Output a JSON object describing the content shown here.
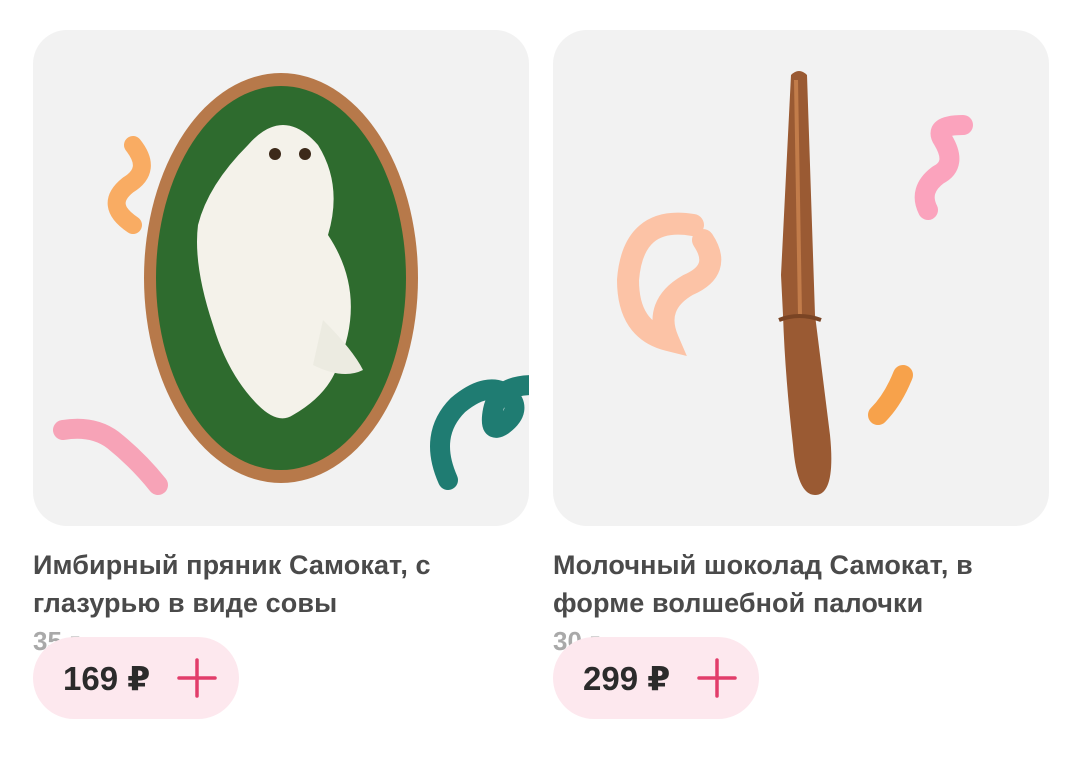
{
  "products": [
    {
      "title_line1": "Имбирный пряник Самокат, с",
      "title_line2": "глазурью в виде совы",
      "weight": "35 г",
      "price": "169 ₽",
      "image": "owl-gingerbread"
    },
    {
      "title_line1": "Молочный шоколад Самокат, в",
      "title_line2": "форме волшебной палочки",
      "weight": "30 г",
      "price": "299 ₽",
      "image": "chocolate-wand"
    }
  ],
  "colors": {
    "card_bg": "#f2f2f2",
    "price_button_bg": "#fde8ee",
    "plus_icon": "#e23d6a",
    "title_text": "#4a4a4a",
    "weight_text": "#a9a9a9"
  },
  "icons": {
    "add": "plus-icon"
  }
}
